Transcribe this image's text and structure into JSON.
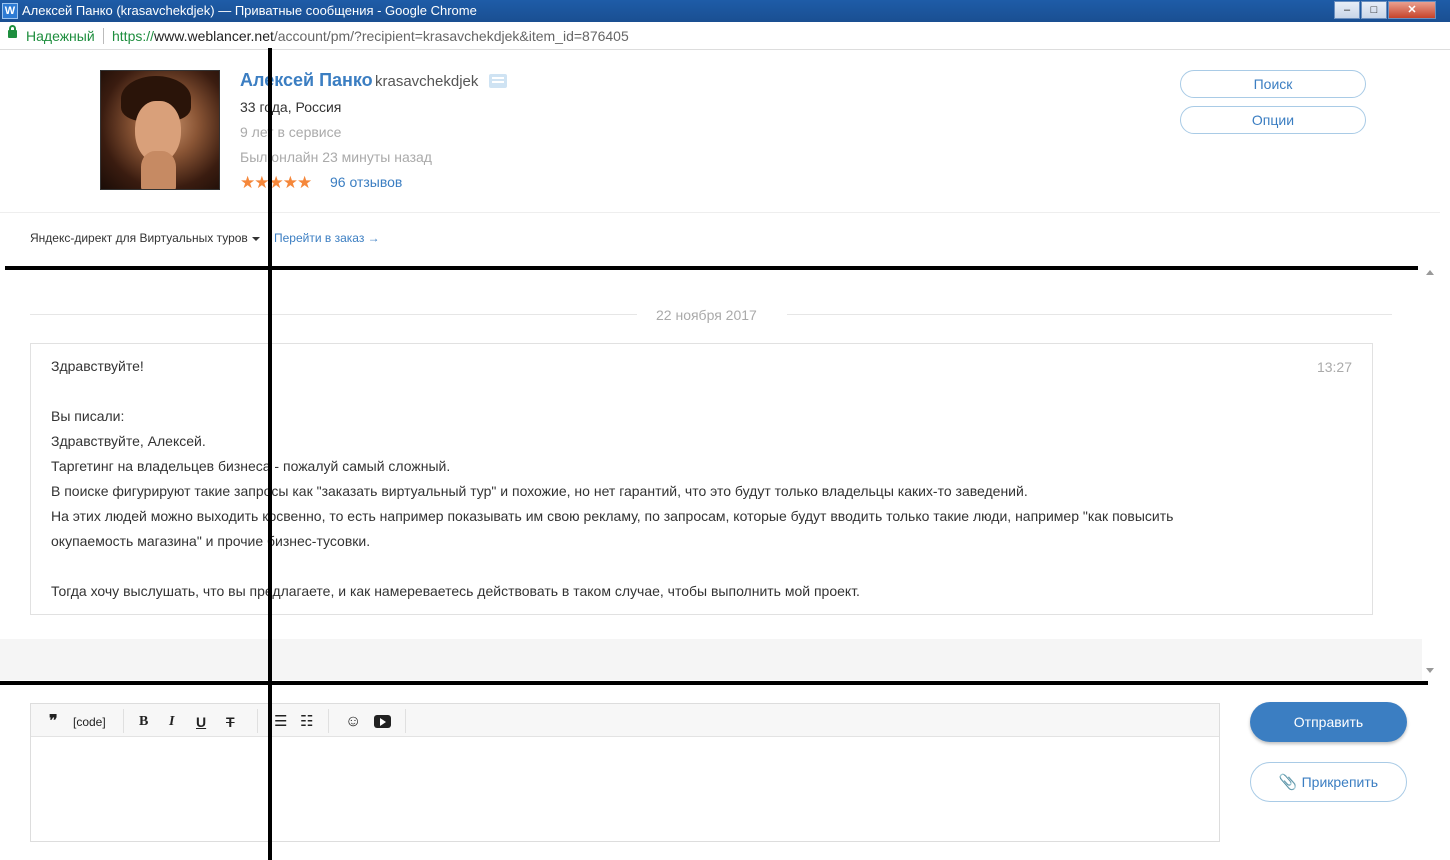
{
  "window": {
    "app_icon": "W",
    "title": "Алексей Панко (krasavchekdjek) — Приватные сообщения - Google Chrome",
    "min": "–",
    "max": "□",
    "close": "✕"
  },
  "address": {
    "secure_label": "Надежный",
    "scheme": "https://",
    "host": "www.weblancer.net",
    "path": "/account/pm/?recipient=krasavchekdjek&item_id=876405"
  },
  "profile": {
    "name": "Алексей Панко",
    "login": "krasavchekdjek",
    "age_location": "33 года, Россия",
    "years": "9 лет в сервисе",
    "online": "Был онлайн 23 минуты назад",
    "rating": 5,
    "stars": "★★★★★",
    "reviews": "96 отзывов"
  },
  "actions": {
    "search": "Поиск",
    "options": "Опции"
  },
  "project": {
    "select_label": "Яндекс-директ для Виртуальных туров",
    "go_order": "Перейти в заказ →"
  },
  "conversation": {
    "date": "22 ноября 2017",
    "message": {
      "time": "13:27",
      "lines": [
        "Здравствуйте!",
        "",
        "Вы писали:",
        "Здравствуйте, Алексей.",
        "Таргетинг на владельцев бизнеса - пожалуй самый сложный.",
        "В поиске фигурируют такие запросы как \"заказать виртуальный тур\" и похожие, но нет гарантий, что это будут только владельцы каких-то заведений.",
        "На этих людей можно выходить косвенно, то есть например показывать им свою рекламу, по запросам, которые будут вводить только такие люди, например \"как повысить",
        "окупаемость магазина\" и прочие бизнес-тусовки.",
        "",
        "Тогда хочу выслушать, что вы предлагаете, и как намереваетесь действовать в таком случае, чтобы выполнить мой проект."
      ]
    }
  },
  "editor": {
    "quote": "❞",
    "code": "[code]",
    "bold": "B",
    "italic": "I",
    "underline": "U",
    "strike": "T",
    "ul": "☰",
    "ol": "☷",
    "smile": "☺",
    "value": ""
  },
  "compose": {
    "send": "Отправить",
    "attach": "Прикрепить",
    "clip": "📎"
  }
}
